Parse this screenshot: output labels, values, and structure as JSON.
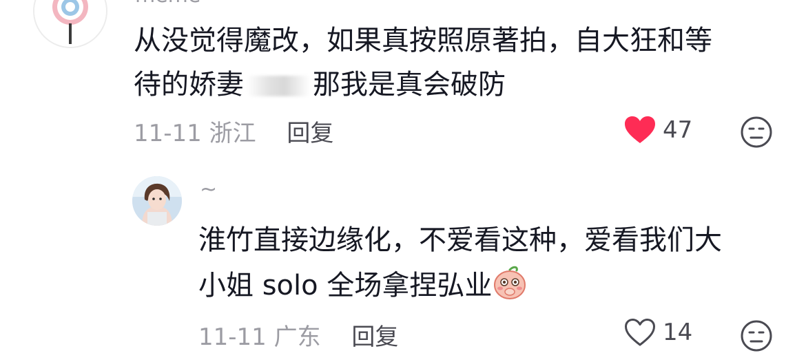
{
  "comments": [
    {
      "username": "meme",
      "text_line1": "从没觉得魔改，如果真按照原著拍，自大狂和等",
      "text_line2_before": "待的娇妻",
      "text_line2_after": "那我是真会破防",
      "date": "11-11",
      "location": "浙江",
      "reply_label": "回复",
      "like_count": "47",
      "liked": true,
      "like_color": "#fe2c55"
    },
    {
      "username": "~",
      "text_line1": "淮竹直接边缘化，不爱看这种，爱看我们大",
      "text_line2": "小姐 solo 全场拿捏弘业",
      "text_emoji": "shy-peach-emoji",
      "date": "11-11",
      "location": "广东",
      "reply_label": "回复",
      "like_count": "14",
      "liked": false
    }
  ],
  "icons": {
    "like_liked": "heart-filled-icon",
    "like_unliked": "heart-outline-icon",
    "dislike": "meh-face-icon"
  }
}
